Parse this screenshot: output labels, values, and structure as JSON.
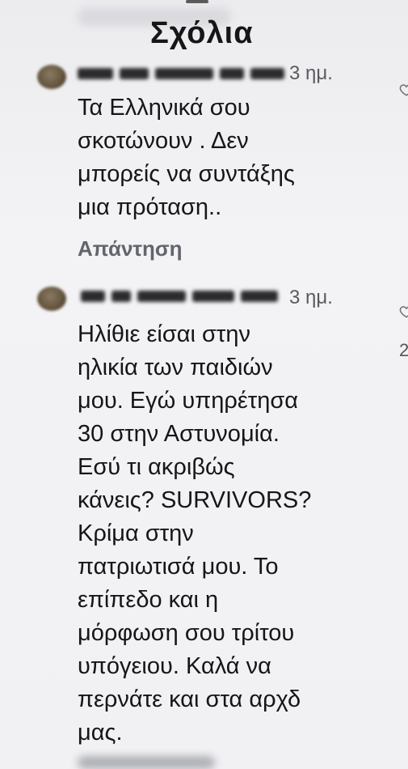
{
  "sheet": {
    "title": "Σχόλια"
  },
  "comments": [
    {
      "timestamp": "3 ημ.",
      "lines": [
        "Τα Ελληνικά σου",
        "σκοτώνουν . Δεν",
        "μπορείς να συντάξης",
        "μια πρόταση.."
      ],
      "reply_label": "Απάντηση",
      "like_icon": "heart-outline-icon"
    },
    {
      "timestamp": "3 ημ.",
      "lines": [
        "Ηλίθιε είσαι στην",
        "ηλικία των παιδιών",
        "μου. Εγώ υπηρέτησα",
        "30 στην Αστυνομία.",
        "Εσύ τι ακριβώς",
        "κάνεις? SURVIVORS?",
        "Κρίμα στην",
        "πατριωτισά μου. Το",
        "επίπεδο και η",
        "μόρφωση σου τρίτου",
        "υπόγειου. Καλά να",
        "περνάτε και στα αρχδ",
        "μας."
      ],
      "like_icon": "heart-outline-icon",
      "edge_count": "2"
    }
  ]
}
